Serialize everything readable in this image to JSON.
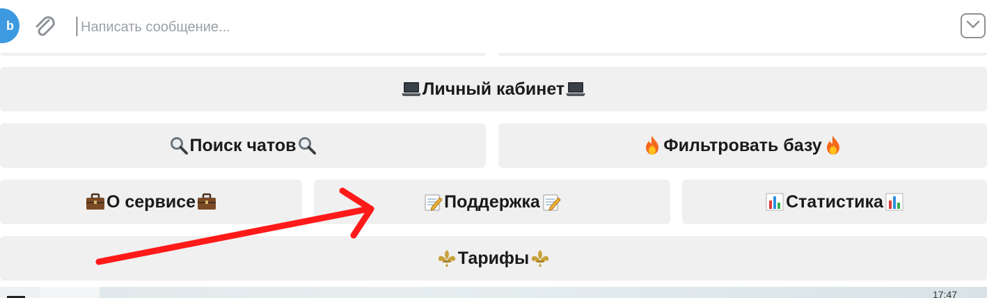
{
  "composer": {
    "placeholder": "Написать сообщение...",
    "value": "",
    "send_label": "b"
  },
  "keyboard": {
    "rows": [
      {
        "buttons": [
          {
            "label": "Личный кабинет",
            "icon": "laptop-icon"
          }
        ]
      },
      {
        "buttons": [
          {
            "label": "Поиск чатов",
            "icon": "magnifier-icon"
          },
          {
            "label": "Фильтровать базу",
            "icon": "fire-icon"
          }
        ]
      },
      {
        "buttons": [
          {
            "label": "О сервисе",
            "icon": "briefcase-icon"
          },
          {
            "label": "Поддержка",
            "icon": "memo-icon"
          },
          {
            "label": "Статистика",
            "icon": "bar-chart-icon"
          }
        ]
      },
      {
        "buttons": [
          {
            "label": "Тарифы",
            "icon": "fleur-de-lis-icon"
          }
        ]
      }
    ]
  },
  "message": {
    "time": "17:47"
  },
  "annotation": {
    "arrow_color": "#ff1a1a",
    "points_to": "Поддержка"
  },
  "colors": {
    "accent": "#3d9ae0",
    "button_bg": "#f0f0f0",
    "text": "#1a1a1a"
  }
}
